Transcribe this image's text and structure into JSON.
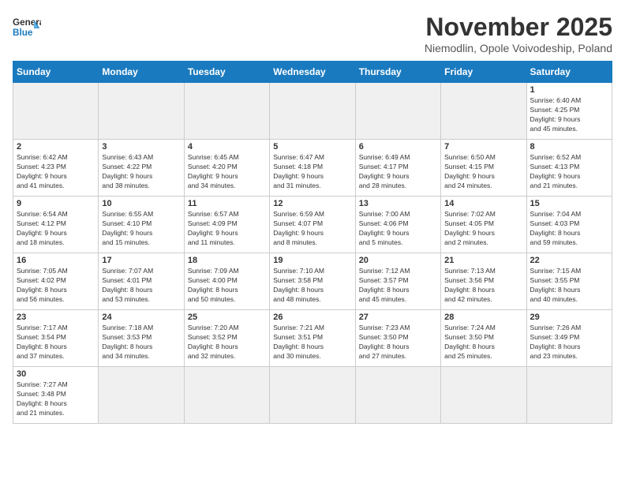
{
  "logo": {
    "line1": "General",
    "line2": "Blue"
  },
  "title": "November 2025",
  "subtitle": "Niemodlin, Opole Voivodeship, Poland",
  "weekdays": [
    "Sunday",
    "Monday",
    "Tuesday",
    "Wednesday",
    "Thursday",
    "Friday",
    "Saturday"
  ],
  "weeks": [
    [
      {
        "day": "",
        "info": ""
      },
      {
        "day": "",
        "info": ""
      },
      {
        "day": "",
        "info": ""
      },
      {
        "day": "",
        "info": ""
      },
      {
        "day": "",
        "info": ""
      },
      {
        "day": "",
        "info": ""
      },
      {
        "day": "1",
        "info": "Sunrise: 6:40 AM\nSunset: 4:25 PM\nDaylight: 9 hours\nand 45 minutes."
      }
    ],
    [
      {
        "day": "2",
        "info": "Sunrise: 6:42 AM\nSunset: 4:23 PM\nDaylight: 9 hours\nand 41 minutes."
      },
      {
        "day": "3",
        "info": "Sunrise: 6:43 AM\nSunset: 4:22 PM\nDaylight: 9 hours\nand 38 minutes."
      },
      {
        "day": "4",
        "info": "Sunrise: 6:45 AM\nSunset: 4:20 PM\nDaylight: 9 hours\nand 34 minutes."
      },
      {
        "day": "5",
        "info": "Sunrise: 6:47 AM\nSunset: 4:18 PM\nDaylight: 9 hours\nand 31 minutes."
      },
      {
        "day": "6",
        "info": "Sunrise: 6:49 AM\nSunset: 4:17 PM\nDaylight: 9 hours\nand 28 minutes."
      },
      {
        "day": "7",
        "info": "Sunrise: 6:50 AM\nSunset: 4:15 PM\nDaylight: 9 hours\nand 24 minutes."
      },
      {
        "day": "8",
        "info": "Sunrise: 6:52 AM\nSunset: 4:13 PM\nDaylight: 9 hours\nand 21 minutes."
      }
    ],
    [
      {
        "day": "9",
        "info": "Sunrise: 6:54 AM\nSunset: 4:12 PM\nDaylight: 9 hours\nand 18 minutes."
      },
      {
        "day": "10",
        "info": "Sunrise: 6:55 AM\nSunset: 4:10 PM\nDaylight: 9 hours\nand 15 minutes."
      },
      {
        "day": "11",
        "info": "Sunrise: 6:57 AM\nSunset: 4:09 PM\nDaylight: 9 hours\nand 11 minutes."
      },
      {
        "day": "12",
        "info": "Sunrise: 6:59 AM\nSunset: 4:07 PM\nDaylight: 9 hours\nand 8 minutes."
      },
      {
        "day": "13",
        "info": "Sunrise: 7:00 AM\nSunset: 4:06 PM\nDaylight: 9 hours\nand 5 minutes."
      },
      {
        "day": "14",
        "info": "Sunrise: 7:02 AM\nSunset: 4:05 PM\nDaylight: 9 hours\nand 2 minutes."
      },
      {
        "day": "15",
        "info": "Sunrise: 7:04 AM\nSunset: 4:03 PM\nDaylight: 8 hours\nand 59 minutes."
      }
    ],
    [
      {
        "day": "16",
        "info": "Sunrise: 7:05 AM\nSunset: 4:02 PM\nDaylight: 8 hours\nand 56 minutes."
      },
      {
        "day": "17",
        "info": "Sunrise: 7:07 AM\nSunset: 4:01 PM\nDaylight: 8 hours\nand 53 minutes."
      },
      {
        "day": "18",
        "info": "Sunrise: 7:09 AM\nSunset: 4:00 PM\nDaylight: 8 hours\nand 50 minutes."
      },
      {
        "day": "19",
        "info": "Sunrise: 7:10 AM\nSunset: 3:58 PM\nDaylight: 8 hours\nand 48 minutes."
      },
      {
        "day": "20",
        "info": "Sunrise: 7:12 AM\nSunset: 3:57 PM\nDaylight: 8 hours\nand 45 minutes."
      },
      {
        "day": "21",
        "info": "Sunrise: 7:13 AM\nSunset: 3:56 PM\nDaylight: 8 hours\nand 42 minutes."
      },
      {
        "day": "22",
        "info": "Sunrise: 7:15 AM\nSunset: 3:55 PM\nDaylight: 8 hours\nand 40 minutes."
      }
    ],
    [
      {
        "day": "23",
        "info": "Sunrise: 7:17 AM\nSunset: 3:54 PM\nDaylight: 8 hours\nand 37 minutes."
      },
      {
        "day": "24",
        "info": "Sunrise: 7:18 AM\nSunset: 3:53 PM\nDaylight: 8 hours\nand 34 minutes."
      },
      {
        "day": "25",
        "info": "Sunrise: 7:20 AM\nSunset: 3:52 PM\nDaylight: 8 hours\nand 32 minutes."
      },
      {
        "day": "26",
        "info": "Sunrise: 7:21 AM\nSunset: 3:51 PM\nDaylight: 8 hours\nand 30 minutes."
      },
      {
        "day": "27",
        "info": "Sunrise: 7:23 AM\nSunset: 3:50 PM\nDaylight: 8 hours\nand 27 minutes."
      },
      {
        "day": "28",
        "info": "Sunrise: 7:24 AM\nSunset: 3:50 PM\nDaylight: 8 hours\nand 25 minutes."
      },
      {
        "day": "29",
        "info": "Sunrise: 7:26 AM\nSunset: 3:49 PM\nDaylight: 8 hours\nand 23 minutes."
      }
    ],
    [
      {
        "day": "30",
        "info": "Sunrise: 7:27 AM\nSunset: 3:48 PM\nDaylight: 8 hours\nand 21 minutes."
      },
      {
        "day": "",
        "info": ""
      },
      {
        "day": "",
        "info": ""
      },
      {
        "day": "",
        "info": ""
      },
      {
        "day": "",
        "info": ""
      },
      {
        "day": "",
        "info": ""
      },
      {
        "day": "",
        "info": ""
      }
    ]
  ]
}
